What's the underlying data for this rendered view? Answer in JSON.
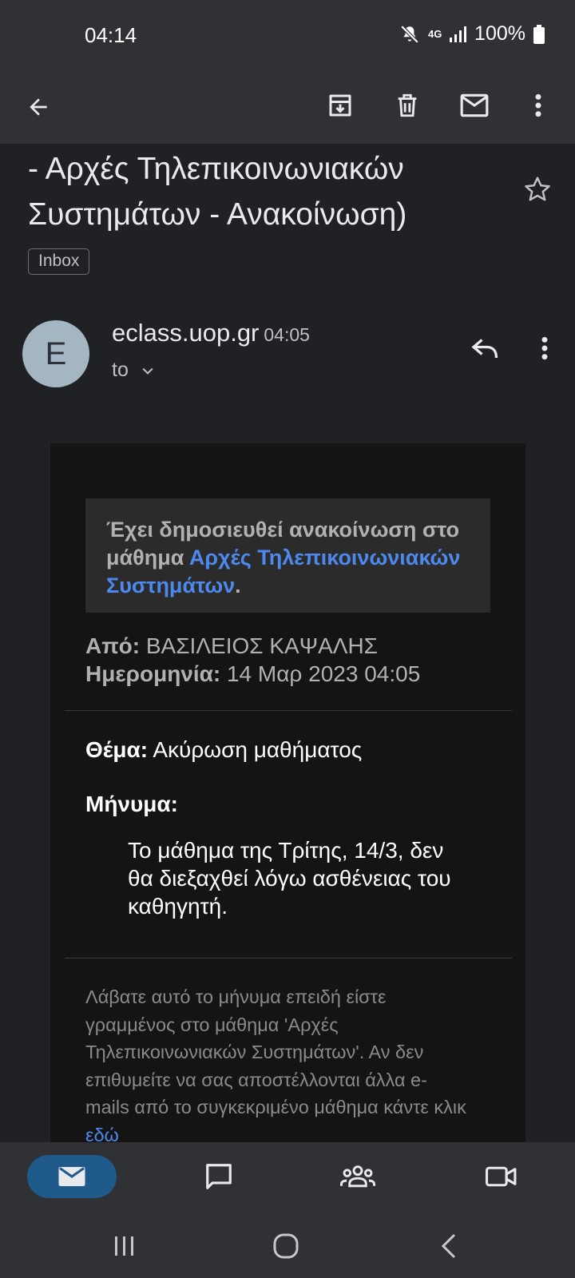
{
  "status": {
    "time": "04:14",
    "network": "4G",
    "battery": "100%"
  },
  "toolbar": {
    "back": "back-arrow-icon",
    "archive": "archive-icon",
    "delete": "delete-icon",
    "mark_unread": "mail-icon",
    "more": "more-vert-icon"
  },
  "email": {
    "subject": "- Αρχές Τηλεπικοινωνιακών Συστημάτων - Ανακοίνωση)",
    "label": "Inbox",
    "avatar_letter": "E",
    "sender": "eclass.uop.gr",
    "time": "04:05",
    "to": "to"
  },
  "body": {
    "notice_prefix": "Έχει δημοσιευθεί ανακοίνωση στο μάθημα ",
    "notice_link": "Αρχές Τηλεπικοινωνιακών Συστημάτων",
    "notice_suffix": ".",
    "from_label": "Από:",
    "from_value": " ΒΑΣΙΛΕΙΟΣ ΚΑΨΑΛΗΣ",
    "date_label": "Ημερομηνία:",
    "date_value": " 14 Μαρ 2023 04:05",
    "subject_label": "Θέμα:",
    "subject_value": " Ακύρωση μαθήματος",
    "message_label": "Μήνυμα:",
    "message_text": "Το μάθημα της Τρίτης, 14/3, δεν θα διεξαχθεί λόγω ασθένειας του καθηγητή.",
    "footer_text": "Λάβατε αυτό το μήνυμα επειδή είστε γραμμένος στο μάθημα 'Αρχές Τηλεπικοινωνιακών Συστημάτων'. Αν δεν επιθυμείτε να σας αποστέλλονται άλλα e-mails από το συγκεκριμένο μάθημα κάντε κλικ ",
    "footer_link": "εδώ"
  },
  "colors": {
    "accent": "#1f5a8b",
    "link": "#4d89ec"
  }
}
